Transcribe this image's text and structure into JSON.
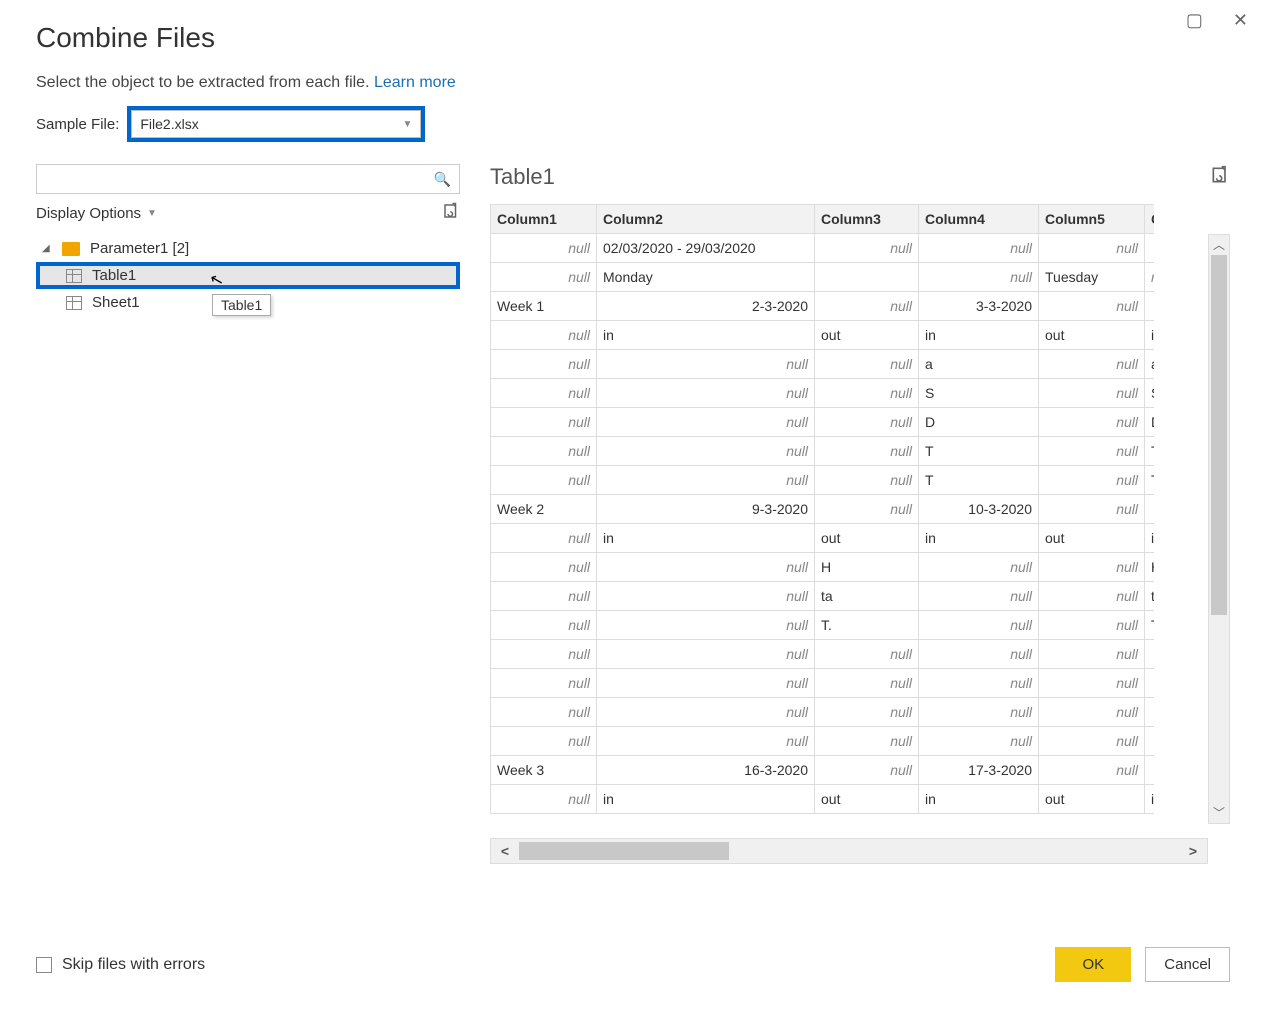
{
  "window": {
    "title": "Combine Files"
  },
  "subtitle_prefix": "Select the object to be extracted from each file. ",
  "learn_more": "Learn more",
  "sample_label": "Sample File:",
  "sample_value": "File2.xlsx",
  "display_options": "Display Options",
  "search_placeholder": "",
  "tree": {
    "root": "Parameter1 [2]",
    "items": [
      {
        "label": "Table1",
        "icon": "table",
        "selected": true
      },
      {
        "label": "Sheet1",
        "icon": "sheet",
        "selected": false
      }
    ]
  },
  "tooltip": "Table1",
  "preview_title": "Table1",
  "columns": [
    "Column1",
    "Column2",
    "Column3",
    "Column4",
    "Column5",
    "Colu"
  ],
  "rows": [
    [
      null,
      "02/03/2020 - 29/03/2020",
      null,
      null,
      null,
      ""
    ],
    [
      null,
      "Monday",
      "",
      null,
      "Tuesday",
      null
    ],
    [
      "Week 1",
      {
        "r": "2-3-2020"
      },
      null,
      {
        "r": "3-3-2020"
      },
      null,
      ""
    ],
    [
      null,
      "in",
      "out",
      "in",
      "out",
      "i"
    ],
    [
      null,
      null,
      null,
      "a",
      null,
      "a"
    ],
    [
      null,
      null,
      null,
      "S",
      null,
      "S"
    ],
    [
      null,
      null,
      null,
      "D",
      null,
      "D"
    ],
    [
      null,
      null,
      null,
      "T",
      null,
      "T"
    ],
    [
      null,
      null,
      null,
      "T",
      null,
      "T"
    ],
    [
      "Week 2",
      {
        "r": "9-3-2020"
      },
      null,
      {
        "r": "10-3-2020"
      },
      null,
      ""
    ],
    [
      null,
      "in",
      "out",
      "in",
      "out",
      "i"
    ],
    [
      null,
      null,
      "H",
      null,
      null,
      "H"
    ],
    [
      null,
      null,
      "ta",
      null,
      null,
      "t"
    ],
    [
      null,
      null,
      "T.",
      null,
      null,
      "T"
    ],
    [
      null,
      null,
      null,
      null,
      null,
      ""
    ],
    [
      null,
      null,
      null,
      null,
      null,
      ""
    ],
    [
      null,
      null,
      null,
      null,
      null,
      ""
    ],
    [
      null,
      null,
      null,
      null,
      null,
      ""
    ],
    [
      "Week 3",
      {
        "r": "16-3-2020"
      },
      null,
      {
        "r": "17-3-2020"
      },
      null,
      ""
    ],
    [
      null,
      "in",
      "out",
      "in",
      "out",
      "i"
    ]
  ],
  "null_text": "null",
  "footer": {
    "skip_label": "Skip files with errors",
    "ok": "OK",
    "cancel": "Cancel"
  }
}
